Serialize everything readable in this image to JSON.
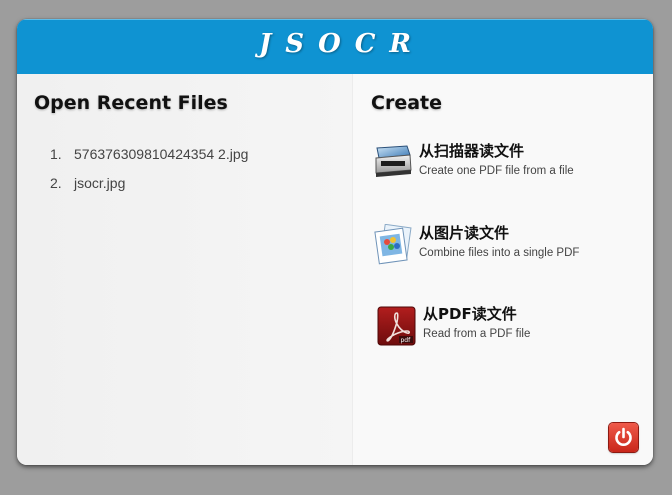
{
  "app": {
    "title": "JSOCR"
  },
  "recent": {
    "heading": "Open Recent Files",
    "files": [
      {
        "num": "1.",
        "name": "576376309810424354 2.jpg"
      },
      {
        "num": "2.",
        "name": "jsocr.jpg"
      }
    ]
  },
  "create": {
    "heading": "Create",
    "actions": [
      {
        "label": "从扫描器读文件",
        "desc": "Create one PDF file from a file",
        "icon": "scanner-icon"
      },
      {
        "label": "从图片读文件",
        "desc": "Combine files into a single PDF",
        "icon": "image-files-icon"
      },
      {
        "label": "从PDF读文件",
        "desc": "Read from a PDF file",
        "icon": "pdf-icon"
      }
    ]
  },
  "footer": {
    "power_icon": "power-icon"
  },
  "colors": {
    "titlebar": "#0f93d2",
    "power": "#d8342a"
  }
}
